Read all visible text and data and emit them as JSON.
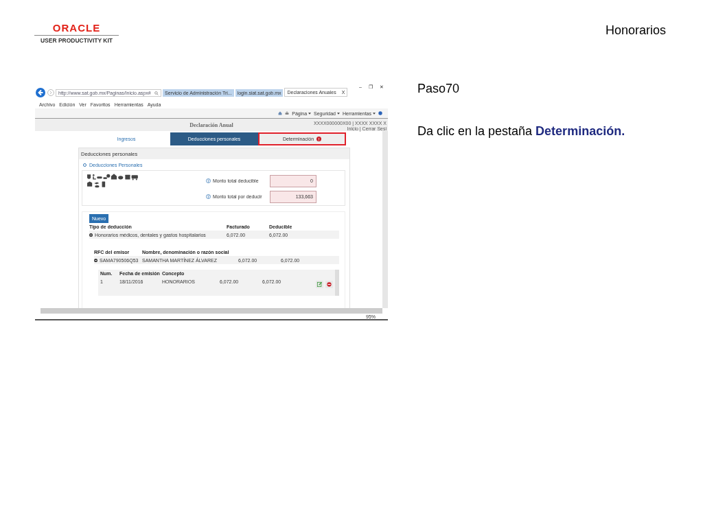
{
  "header": {
    "logo": {
      "brand": "ORACLE",
      "product": "USER PRODUCTIVITY KIT"
    },
    "title": "Honorarios"
  },
  "step": {
    "label": "Paso70",
    "instruction": "Da clic en la pestaña **Determinación.**"
  },
  "screenshot": {
    "browser": {
      "address": "http://www.sat.gob.mx/Paginas/Inicio.aspx#",
      "tabs": [
        {
          "label": "Servicio de Administración Tri...",
          "selected": false
        },
        {
          "label": "login.siat.sat.gob.mx",
          "selected": false
        },
        {
          "label": "Declaraciones Anuales",
          "selected": true,
          "close": "X"
        }
      ],
      "window_controls": [
        "–",
        "❐",
        "✕"
      ],
      "menu": [
        "Archivo",
        "Edición",
        "Ver",
        "Favoritos",
        "Herramientas",
        "Ayuda"
      ],
      "commands": [
        "Página",
        "Seguridad",
        "Herramientas"
      ],
      "zoom": "95%"
    },
    "page": {
      "title": "Declaración Anual",
      "user": "XXXX000000X00 | XXXX XXXX X",
      "links": "Inicio | Cerrar Sesi",
      "tabs": [
        {
          "label": "Ingresos",
          "selected": false,
          "highlighted": false
        },
        {
          "label": "Deducciones personales",
          "selected": true,
          "highlighted": false
        },
        {
          "label": "Determinación",
          "selected": false,
          "highlighted": true,
          "badge": "!"
        }
      ],
      "panel_title": "Deducciones personales",
      "section": {
        "label": "Deducciones Personales",
        "expanded": true
      },
      "totals": [
        {
          "label": "Monto total deducible",
          "value": "0"
        },
        {
          "label": "Monto total por deducir",
          "value": "133,663"
        }
      ],
      "new_button": "Nuevo",
      "deductions": {
        "columns": [
          "Tipo de deducción",
          "Facturado",
          "Deducible"
        ],
        "rows": [
          {
            "expanded": true,
            "cells": [
              "Honorarios médicos, dentales y gastos hospitalarios",
              "6,072.00",
              "6,072.00"
            ]
          }
        ]
      },
      "issuers": {
        "columns": [
          "RFC del emisor",
          "Nombre, denominación o razón social"
        ],
        "rows": [
          {
            "expanded": true,
            "cells": [
              "SAMA790506Q53",
              "SAMANTHA MARTÍNEZ ÁLVAREZ",
              "6,072.00",
              "6,072.00"
            ]
          }
        ]
      },
      "invoices": {
        "columns": [
          "Num.",
          "Fecha de emisión",
          "Concepto"
        ],
        "rows": [
          {
            "cells": [
              "1",
              "18/11/2016",
              "HONORARIOS",
              "6,072.00",
              "6,072.00"
            ]
          }
        ]
      }
    }
  }
}
